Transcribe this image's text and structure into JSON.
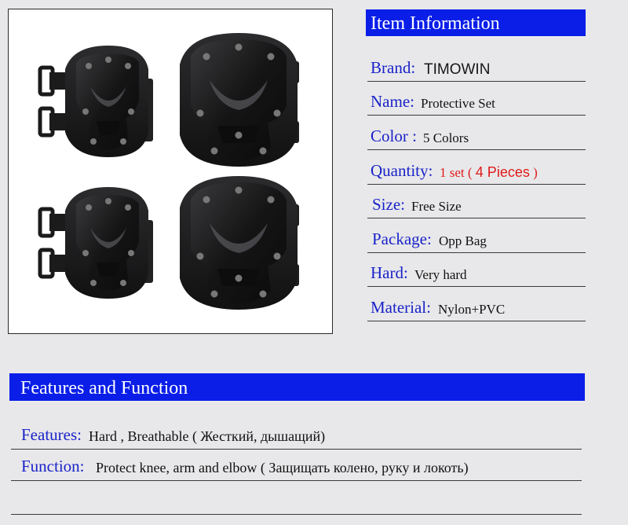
{
  "photo": {
    "subject": "knee-and-elbow-pads-set"
  },
  "item_information": {
    "title": "Item Information",
    "rows": [
      {
        "label": "Brand:",
        "value": "TIMOWIN"
      },
      {
        "label": "Name:",
        "value": "Protective  Set"
      },
      {
        "label": "Color :",
        "value": "5 Colors"
      },
      {
        "label": "Quantity:",
        "value_prefix": "1 set ( ",
        "value_big": "4 Pieces",
        "value_suffix": " )"
      },
      {
        "label": "Size:",
        "value": "Free Size"
      },
      {
        "label": "Package:",
        "value": "Opp Bag"
      },
      {
        "label": "Hard:",
        "value": "Very hard"
      },
      {
        "label": "Material:",
        "value": "Nylon+PVC"
      }
    ]
  },
  "features_section": {
    "title": "Features and Function",
    "features": {
      "label": "Features:",
      "value": "Hard , Breathable  ( Жесткий, дышащий)"
    },
    "function": {
      "label": "Function:",
      "value": "Protect knee, arm and elbow  ( Защищать колено, руку и локоть)"
    }
  },
  "colors": {
    "header_blue": "#0a1ee8",
    "label_blue": "#1a23c8",
    "accent_red": "#e01a1a"
  }
}
